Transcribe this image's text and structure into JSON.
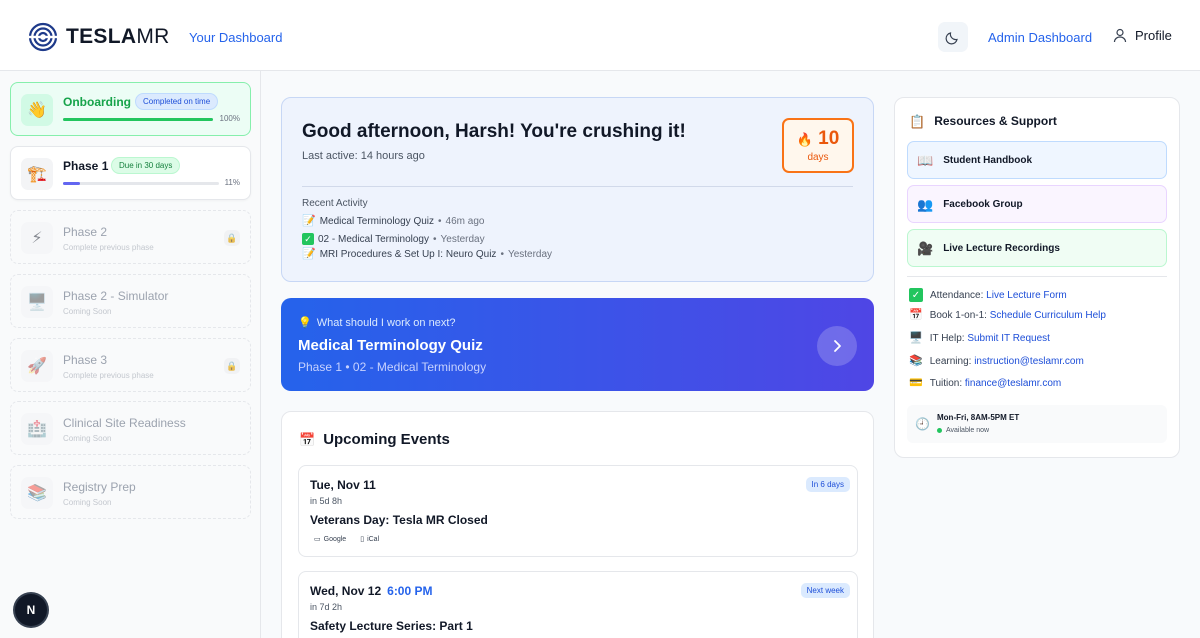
{
  "header": {
    "logo_bold": "TESLA",
    "logo_thin": "MR",
    "nav_dashboard": "Your Dashboard",
    "admin_dashboard": "Admin Dashboard",
    "profile": "Profile"
  },
  "sidebar": {
    "phases": [
      {
        "title": "Onboarding",
        "badge": "Completed on time",
        "percent": "100%",
        "progress": 1.0,
        "icon": "wave-icon",
        "state": "done"
      },
      {
        "title": "Phase 1",
        "badge": "Due in 30 days",
        "percent": "11%",
        "progress": 0.11,
        "icon": "crane-icon",
        "state": "active"
      },
      {
        "title": "Phase 2",
        "subtitle": "Complete previous phase",
        "icon": "bolt-icon",
        "state": "locked"
      },
      {
        "title": "Phase 2 - Simulator",
        "subtitle": "Coming Soon",
        "icon": "monitor-icon",
        "state": "locked"
      },
      {
        "title": "Phase 3",
        "subtitle": "Complete previous phase",
        "icon": "rocket-icon",
        "state": "locked"
      },
      {
        "title": "Clinical Site Readiness",
        "subtitle": "Coming Soon",
        "icon": "hospital-icon",
        "state": "locked"
      },
      {
        "title": "Registry Prep",
        "subtitle": "Coming Soon",
        "icon": "books-icon",
        "state": "locked"
      }
    ],
    "n_button": "N"
  },
  "welcome": {
    "greeting": "Good afternoon, Harsh! You're crushing it!",
    "last_active": "Last active: 14 hours ago",
    "streak_value": "10",
    "streak_label": "days",
    "recent_title": "Recent Activity",
    "activities": [
      {
        "name": "Medical Terminology Quiz",
        "sep": "•",
        "ago": "46m ago",
        "icon": "memo-icon"
      },
      {
        "name": "02 - Medical Terminology",
        "sep": "•",
        "ago": "Yesterday",
        "icon": "check-icon"
      },
      {
        "name": "MRI Procedures & Set Up I: Neuro Quiz",
        "sep": "•",
        "ago": "Yesterday",
        "icon": "memo-icon"
      }
    ]
  },
  "next": {
    "question": "What should I work on next?",
    "title": "Medical Terminology Quiz",
    "subtitle": "Phase 1 • 02 - Medical Terminology"
  },
  "events": {
    "title": "Upcoming Events",
    "items": [
      {
        "date": "Tue, Nov 11",
        "time": "",
        "in": "in 5d 8h",
        "name": "Veterans Day: Tesla MR Closed",
        "badge": "In 6 days",
        "links": [
          "Google",
          "iCal"
        ]
      },
      {
        "date": "Wed, Nov 12",
        "time": "6:00 PM",
        "in": "in 7d 2h",
        "name": "Safety Lecture Series: Part 1",
        "badge": "Next week"
      }
    ]
  },
  "resources": {
    "title": "Resources & Support",
    "buttons": [
      {
        "label": "Student Handbook",
        "icon": "book-icon"
      },
      {
        "label": "Facebook Group",
        "icon": "people-icon"
      },
      {
        "label": "Live Lecture Recordings",
        "icon": "camera-icon"
      }
    ],
    "lines": [
      {
        "label": "Attendance:",
        "link": "Live Lecture Form",
        "icon": "check-icon"
      },
      {
        "label": "Book 1-on-1:",
        "link": "Schedule Curriculum Help",
        "icon": "calendar-icon"
      },
      {
        "label": "IT Help:",
        "link": "Submit IT Request",
        "icon": "computer-icon"
      },
      {
        "label": "Learning:",
        "link": "instruction@teslamr.com",
        "icon": "books-icon"
      },
      {
        "label": "Tuition:",
        "link": "finance@teslamr.com",
        "icon": "card-icon"
      }
    ],
    "hours": "Mon-Fri, 8AM-5PM ET",
    "availability": "Available now"
  },
  "colors": {
    "primary": "#2563eb",
    "success": "#16a34a",
    "streak": "#ea580c"
  }
}
